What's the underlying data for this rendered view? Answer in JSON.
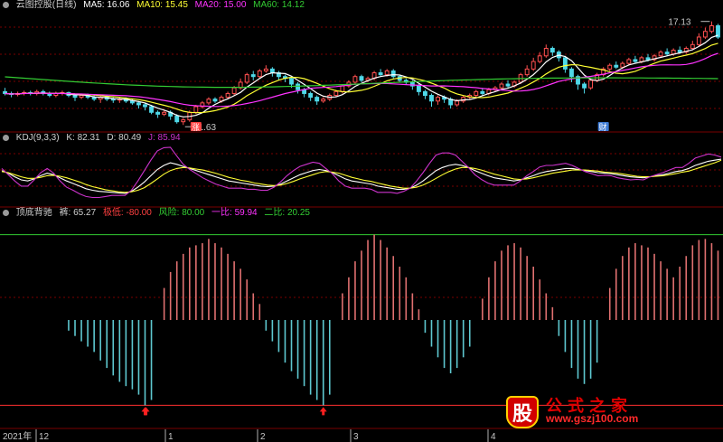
{
  "colors": {
    "background": "#000000",
    "grid": "#7a0000",
    "up": "#ff5050",
    "down": "#4ed8e8",
    "ma5": "#ffffff",
    "ma10": "#ffff33",
    "ma20": "#ff33ff",
    "ma60": "#33cc33",
    "kdj_k": "#ffffff",
    "kdj_d": "#ffff33",
    "kdj_j": "#cc33cc",
    "hist_pos": "#e07070",
    "hist_neg": "#5ec8d0",
    "green_line": "#33cc33",
    "red_line": "#ff3030"
  },
  "main_panel": {
    "title": "云图控股(日线)",
    "ma5": "MA5: 16.06",
    "ma10": "MA10: 15.45",
    "ma20": "MA20: 15.00",
    "ma60": "MA60: 14.12",
    "high_label": "17.13",
    "low_label": "11.63",
    "marker_zhang": "涨",
    "marker_cai": "财"
  },
  "kdj_panel": {
    "title": "KDJ(9,3,3)",
    "k": "K: 82.31",
    "d": "D: 80.49",
    "j": "J: 85.94"
  },
  "div_panel": {
    "title": "顶底背驰",
    "bar": "裤: 65.27",
    "extreme": "极低: -80.00",
    "risk": "风险: 80.00",
    "first": "一比: 59.94",
    "second": "二比: 20.25"
  },
  "x_axis": {
    "year": "2021年",
    "ticks": [
      "12",
      "1",
      "2",
      "3",
      "4"
    ]
  },
  "watermark": {
    "brand": "股",
    "name": "公式之家",
    "url": "www.gszj100.com"
  },
  "chart_data": [
    {
      "type": "candlestick",
      "title": "云图控股(日线)",
      "y_labels": {
        "high": 17.13,
        "low": 11.63
      },
      "ohlc": [
        [
          13.4,
          13.3,
          13.6,
          13.2
        ],
        [
          13.3,
          13.25,
          13.4,
          13.1
        ],
        [
          13.25,
          13.3,
          13.4,
          13.15
        ],
        [
          13.3,
          13.35,
          13.45,
          13.2
        ],
        [
          13.35,
          13.3,
          13.45,
          13.2
        ],
        [
          13.3,
          13.4,
          13.5,
          13.2
        ],
        [
          13.4,
          13.3,
          13.5,
          13.2
        ],
        [
          13.3,
          13.2,
          13.4,
          13.1
        ],
        [
          13.2,
          13.3,
          13.4,
          13.1
        ],
        [
          13.3,
          13.35,
          13.45,
          13.2
        ],
        [
          13.35,
          13.2,
          13.4,
          13.1
        ],
        [
          13.2,
          13.1,
          13.3,
          12.9
        ],
        [
          13.1,
          13.2,
          13.3,
          13.0
        ],
        [
          13.2,
          13.1,
          13.3,
          13.0
        ],
        [
          13.1,
          13.0,
          13.2,
          12.9
        ],
        [
          13.0,
          13.1,
          13.2,
          12.8
        ],
        [
          13.1,
          13.0,
          13.2,
          12.9
        ],
        [
          13.0,
          12.95,
          13.1,
          12.8
        ],
        [
          12.95,
          13.0,
          13.1,
          12.8
        ],
        [
          13.0,
          12.9,
          13.1,
          12.8
        ],
        [
          12.9,
          12.8,
          13.0,
          12.7
        ],
        [
          12.8,
          12.7,
          12.9,
          12.5
        ],
        [
          12.7,
          12.6,
          12.8,
          12.4
        ],
        [
          12.6,
          12.3,
          12.7,
          12.2
        ],
        [
          12.3,
          12.2,
          12.4,
          12.0
        ],
        [
          12.2,
          12.3,
          12.4,
          12.1
        ],
        [
          12.3,
          12.1,
          12.4,
          11.9
        ],
        [
          12.1,
          11.8,
          12.2,
          11.7
        ],
        [
          11.8,
          11.9,
          12.0,
          11.63
        ],
        [
          11.9,
          12.3,
          12.4,
          11.8
        ],
        [
          12.3,
          12.6,
          12.7,
          12.2
        ],
        [
          12.6,
          12.8,
          12.9,
          12.5
        ],
        [
          12.8,
          13.0,
          13.1,
          12.7
        ],
        [
          13.0,
          12.9,
          13.1,
          12.8
        ],
        [
          12.9,
          13.1,
          13.2,
          12.8
        ],
        [
          13.1,
          13.3,
          13.4,
          13.0
        ],
        [
          13.3,
          13.6,
          13.7,
          13.2
        ],
        [
          13.6,
          13.9,
          14.1,
          13.5
        ],
        [
          13.9,
          14.3,
          14.4,
          13.8
        ],
        [
          14.3,
          14.2,
          14.5,
          14.0
        ],
        [
          14.2,
          14.5,
          14.6,
          14.1
        ],
        [
          14.5,
          14.6,
          14.8,
          14.4
        ],
        [
          14.6,
          14.4,
          14.7,
          14.2
        ],
        [
          14.4,
          14.2,
          14.5,
          14.0
        ],
        [
          14.2,
          14.1,
          14.3,
          13.9
        ],
        [
          14.1,
          13.8,
          14.2,
          13.6
        ],
        [
          13.8,
          13.5,
          13.9,
          13.3
        ],
        [
          13.5,
          13.3,
          13.6,
          13.1
        ],
        [
          13.3,
          13.1,
          13.4,
          12.9
        ],
        [
          13.1,
          12.9,
          13.2,
          12.7
        ],
        [
          12.9,
          13.0,
          13.1,
          12.8
        ],
        [
          13.0,
          13.2,
          13.3,
          12.9
        ],
        [
          13.2,
          13.4,
          13.5,
          13.1
        ],
        [
          13.4,
          13.7,
          13.8,
          13.3
        ],
        [
          13.7,
          13.9,
          14.0,
          13.6
        ],
        [
          13.9,
          14.2,
          14.3,
          13.8
        ],
        [
          14.2,
          14.0,
          14.3,
          13.9
        ],
        [
          14.0,
          14.1,
          14.2,
          13.9
        ],
        [
          14.1,
          14.4,
          14.5,
          14.0
        ],
        [
          14.4,
          14.3,
          14.6,
          14.2
        ],
        [
          14.3,
          14.5,
          14.6,
          14.2
        ],
        [
          14.5,
          14.2,
          14.6,
          14.1
        ],
        [
          14.2,
          14.0,
          14.3,
          13.9
        ],
        [
          14.0,
          13.9,
          14.1,
          13.8
        ],
        [
          13.9,
          13.7,
          14.0,
          13.5
        ],
        [
          13.7,
          13.4,
          13.8,
          13.2
        ],
        [
          13.4,
          13.2,
          13.5,
          13.0
        ],
        [
          13.2,
          12.9,
          13.3,
          12.6
        ],
        [
          12.9,
          13.1,
          13.2,
          12.7
        ],
        [
          13.1,
          13.0,
          13.2,
          12.8
        ],
        [
          13.0,
          12.7,
          13.1,
          12.5
        ],
        [
          12.7,
          12.9,
          13.0,
          12.6
        ],
        [
          12.9,
          13.1,
          13.2,
          12.8
        ],
        [
          13.1,
          13.2,
          13.3,
          13.0
        ],
        [
          13.2,
          13.4,
          13.5,
          13.1
        ],
        [
          13.4,
          13.3,
          13.6,
          13.2
        ],
        [
          13.3,
          13.5,
          13.6,
          13.2
        ],
        [
          13.5,
          13.6,
          13.7,
          13.4
        ],
        [
          13.6,
          13.8,
          13.9,
          13.5
        ],
        [
          13.8,
          13.7,
          14.0,
          13.6
        ],
        [
          13.7,
          13.9,
          14.0,
          13.6
        ],
        [
          13.9,
          14.3,
          14.4,
          13.8
        ],
        [
          14.3,
          14.6,
          14.8,
          14.2
        ],
        [
          14.6,
          15.0,
          15.2,
          14.5
        ],
        [
          15.0,
          15.3,
          15.5,
          14.9
        ],
        [
          15.3,
          15.7,
          15.9,
          15.2
        ],
        [
          15.7,
          15.5,
          15.8,
          15.3
        ],
        [
          15.5,
          15.2,
          15.6,
          15.0
        ],
        [
          15.2,
          14.6,
          15.3,
          14.4
        ],
        [
          14.6,
          14.2,
          14.7,
          13.9
        ],
        [
          14.2,
          13.8,
          14.3,
          13.5
        ],
        [
          13.8,
          13.6,
          13.9,
          13.3
        ],
        [
          13.6,
          14.0,
          14.1,
          13.5
        ],
        [
          14.0,
          14.3,
          14.4,
          13.9
        ],
        [
          14.3,
          14.6,
          14.7,
          14.2
        ],
        [
          14.6,
          14.8,
          14.9,
          14.5
        ],
        [
          14.8,
          14.7,
          15.0,
          14.6
        ],
        [
          14.7,
          14.9,
          15.0,
          14.6
        ],
        [
          14.9,
          15.1,
          15.2,
          14.8
        ],
        [
          15.1,
          15.0,
          15.3,
          14.9
        ],
        [
          15.0,
          15.2,
          15.3,
          14.9
        ],
        [
          15.2,
          15.1,
          15.4,
          15.0
        ],
        [
          15.1,
          15.3,
          15.4,
          15.0
        ],
        [
          15.3,
          15.5,
          15.6,
          15.2
        ],
        [
          15.5,
          15.4,
          15.7,
          15.3
        ],
        [
          15.4,
          15.6,
          15.7,
          15.3
        ],
        [
          15.6,
          15.5,
          15.8,
          15.4
        ],
        [
          15.5,
          15.7,
          15.8,
          15.4
        ],
        [
          15.7,
          15.9,
          16.1,
          15.6
        ],
        [
          15.9,
          16.3,
          16.5,
          15.8
        ],
        [
          16.3,
          16.6,
          16.8,
          16.2
        ],
        [
          16.6,
          16.9,
          17.13,
          16.5
        ],
        [
          16.9,
          16.3,
          17.0,
          16.2
        ]
      ]
    },
    {
      "type": "line",
      "title": "KDJ(9,3,3)",
      "ylim": [
        0,
        100
      ],
      "series": [
        {
          "name": "K",
          "values": [
            60,
            55,
            48,
            42,
            40,
            44,
            50,
            55,
            52,
            46,
            40,
            35,
            30,
            25,
            22,
            20,
            19,
            18,
            17,
            16,
            20,
            28,
            38,
            50,
            62,
            70,
            75,
            72,
            68,
            64,
            60,
            56,
            52,
            48,
            44,
            40,
            38,
            36,
            34,
            32,
            30,
            29,
            30,
            34,
            40,
            46,
            52,
            56,
            60,
            62,
            60,
            56,
            50,
            44,
            40,
            38,
            36,
            34,
            30,
            28,
            26,
            24,
            24,
            26,
            32,
            40,
            50,
            60,
            66,
            70,
            72,
            70,
            66,
            60,
            55,
            50,
            46,
            44,
            42,
            40,
            42,
            46,
            50,
            55,
            58,
            60,
            62,
            64,
            64,
            62,
            60,
            58,
            56,
            55,
            54,
            52,
            50,
            48,
            47,
            46,
            48,
            50,
            52,
            55,
            58,
            60,
            64,
            70,
            74,
            78,
            80,
            82
          ]
        },
        {
          "name": "D",
          "values": [
            58,
            56,
            52,
            48,
            45,
            45,
            47,
            50,
            51,
            49,
            46,
            42,
            38,
            33,
            29,
            26,
            23,
            21,
            19,
            18,
            19,
            22,
            27,
            35,
            44,
            53,
            60,
            64,
            66,
            65,
            63,
            61,
            58,
            55,
            51,
            47,
            44,
            41,
            39,
            36,
            34,
            32,
            31,
            32,
            35,
            39,
            44,
            48,
            52,
            56,
            58,
            57,
            55,
            51,
            47,
            44,
            41,
            39,
            36,
            33,
            30,
            28,
            26,
            26,
            28,
            32,
            38,
            45,
            52,
            58,
            63,
            66,
            66,
            64,
            61,
            57,
            53,
            50,
            47,
            44,
            43,
            44,
            46,
            49,
            52,
            55,
            57,
            59,
            61,
            61,
            61,
            60,
            59,
            57,
            56,
            55,
            53,
            51,
            49,
            48,
            48,
            49,
            50,
            52,
            54,
            57,
            59,
            63,
            67,
            71,
            75,
            80
          ]
        },
        {
          "name": "J",
          "values": [
            64,
            52,
            40,
            30,
            30,
            42,
            56,
            64,
            55,
            40,
            28,
            22,
            15,
            10,
            8,
            8,
            10,
            12,
            12,
            12,
            22,
            40,
            60,
            80,
            98,
            104,
            105,
            88,
            72,
            62,
            54,
            46,
            40,
            34,
            30,
            26,
            26,
            26,
            24,
            24,
            22,
            22,
            28,
            38,
            50,
            60,
            68,
            72,
            76,
            74,
            64,
            54,
            40,
            30,
            26,
            26,
            26,
            24,
            18,
            18,
            18,
            16,
            20,
            26,
            40,
            56,
            74,
            90,
            94,
            94,
            90,
            78,
            66,
            52,
            43,
            36,
            32,
            32,
            32,
            32,
            40,
            50,
            58,
            67,
            70,
            70,
            72,
            74,
            70,
            64,
            58,
            54,
            50,
            51,
            50,
            46,
            44,
            42,
            43,
            42,
            48,
            52,
            56,
            61,
            66,
            66,
            74,
            84,
            88,
            92,
            90,
            86
          ]
        }
      ]
    },
    {
      "type": "bar",
      "title": "顶底背驰",
      "ylim": [
        -100,
        100
      ],
      "reference_lines": {
        "风险": 80,
        "极低": -80
      },
      "values": [
        0,
        0,
        0,
        0,
        0,
        0,
        0,
        0,
        0,
        0,
        -10,
        -15,
        -20,
        -25,
        -30,
        -38,
        -45,
        -52,
        -58,
        -62,
        -65,
        -70,
        -80,
        -75,
        0,
        30,
        45,
        55,
        62,
        68,
        70,
        72,
        76,
        72,
        68,
        62,
        55,
        48,
        38,
        25,
        15,
        -10,
        -20,
        -30,
        -40,
        -48,
        -55,
        -62,
        -70,
        -75,
        -80,
        -70,
        0,
        25,
        40,
        55,
        65,
        75,
        80,
        75,
        68,
        60,
        50,
        40,
        25,
        10,
        -12,
        -25,
        -35,
        -45,
        -50,
        -45,
        -35,
        -25,
        0,
        20,
        40,
        55,
        65,
        70,
        72,
        68,
        60,
        50,
        38,
        25,
        12,
        -15,
        -30,
        -45,
        -55,
        -60,
        -55,
        -40,
        0,
        30,
        48,
        60,
        68,
        72,
        70,
        68,
        62,
        55,
        48,
        40,
        50,
        60,
        70,
        75,
        76,
        72,
        65
      ]
    }
  ]
}
